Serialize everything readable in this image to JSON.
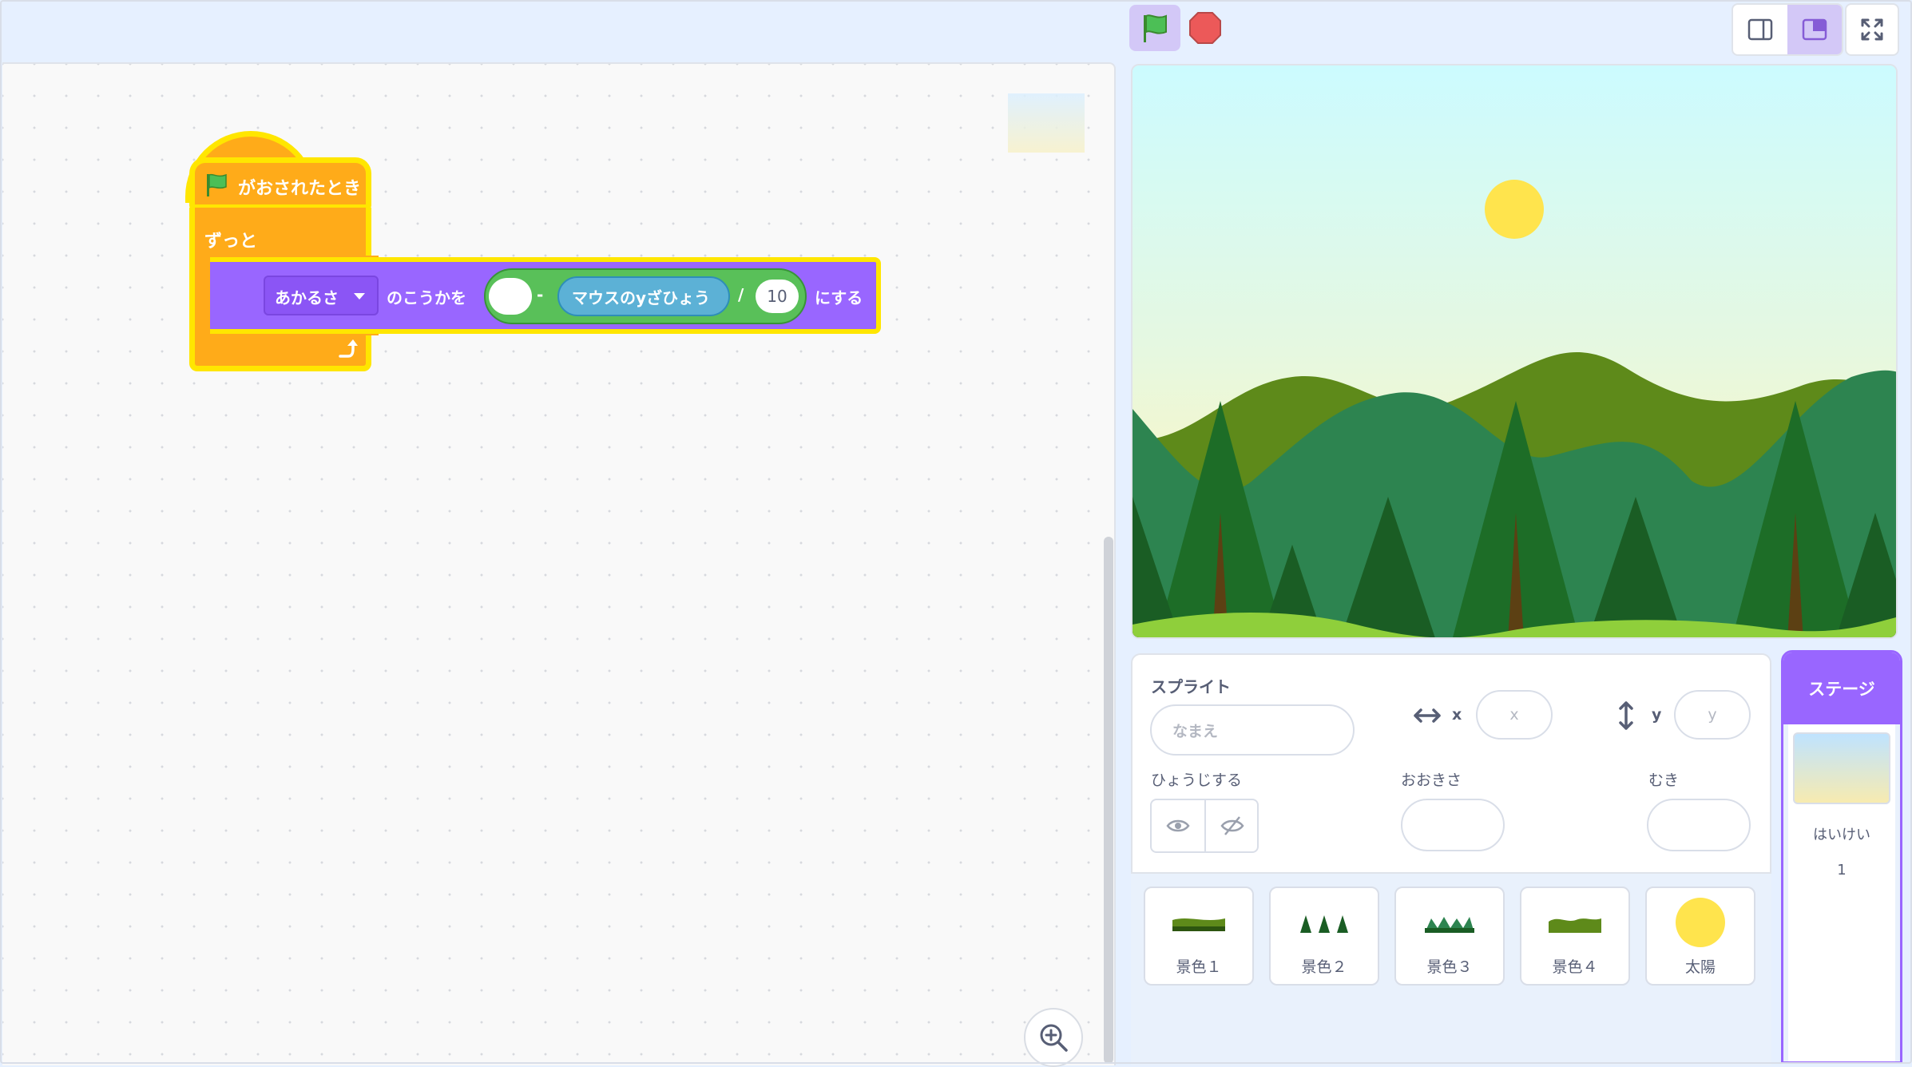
{
  "colors": {
    "motion": "#4c97ff",
    "looks": "#9966ff",
    "control": "#ffab19",
    "operators": "#59c059",
    "sensing": "#5cb1d6",
    "highlight": "#ffe600",
    "accent": "#855cd6"
  },
  "icons": {
    "green_flag": "green-flag-icon",
    "stop": "stop-icon",
    "small_stage": "small-stage-icon",
    "large_stage": "large-stage-icon",
    "fullscreen": "fullscreen-icon",
    "zoom_in": "zoom-in-icon",
    "loop_arrow": "loop-arrow-icon",
    "dropdown": "dropdown-arrow-icon",
    "show": "eye-icon",
    "hide": "eye-crossed-icon",
    "x_arrow": "horizontal-arrows-icon",
    "y_arrow": "vertical-arrows-icon"
  },
  "script": {
    "hat_label": "がおされたとき",
    "forever_label": "ずっと",
    "looks_block": {
      "effect": "あかるさ",
      "middle": "のこうかを",
      "minus": "-",
      "sensing": "マウスのyざひょう",
      "divide": "/",
      "divisor": "10",
      "end": "にする"
    }
  },
  "sprite_info": {
    "title": "スプライト",
    "name_placeholder": "なまえ",
    "x_label": "x",
    "x_placeholder": "x",
    "y_label": "y",
    "y_placeholder": "y",
    "show_label": "ひょうじする",
    "size_label": "おおきさ",
    "direction_label": "むき"
  },
  "sprites": [
    {
      "name": "景色１"
    },
    {
      "name": "景色２"
    },
    {
      "name": "景色３"
    },
    {
      "name": "景色４"
    },
    {
      "name": "太陽"
    }
  ],
  "stage_selector": {
    "header": "ステージ",
    "backdrops_label": "はいけい",
    "backdrop_count": "1"
  }
}
